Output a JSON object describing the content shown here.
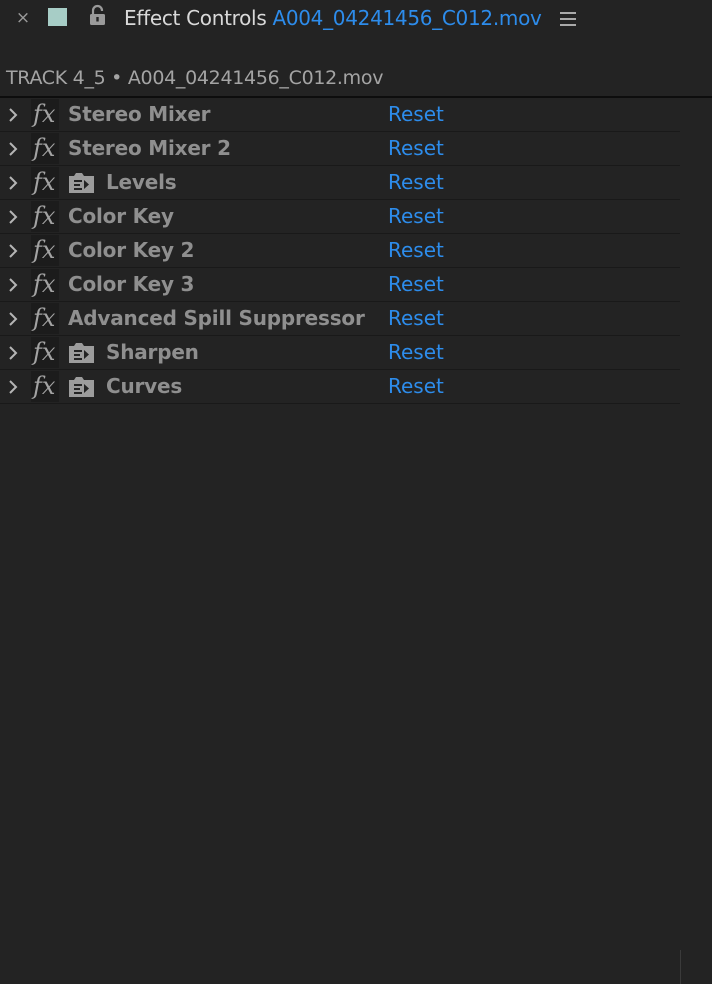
{
  "panel": {
    "title": "Effect Controls",
    "clip_name": "A004_04241456_C012.mov",
    "label_color": "#a7cdc6",
    "accent_color": "#2d8ceb",
    "close_glyph": "×",
    "icons": {
      "close": "close-icon",
      "lock": "lock-icon",
      "menu": "hamburger-menu-icon"
    }
  },
  "track_label": "TRACK 4_5 • A004_04241456_C012.mov",
  "effects": [
    {
      "name": "Stereo Mixer",
      "reset_label": "Reset",
      "has_preset_icon": false
    },
    {
      "name": "Stereo Mixer 2",
      "reset_label": "Reset",
      "has_preset_icon": false
    },
    {
      "name": "Levels",
      "reset_label": "Reset",
      "has_preset_icon": true
    },
    {
      "name": "Color Key",
      "reset_label": "Reset",
      "has_preset_icon": false
    },
    {
      "name": "Color Key 2",
      "reset_label": "Reset",
      "has_preset_icon": false
    },
    {
      "name": "Color Key 3",
      "reset_label": "Reset",
      "has_preset_icon": false
    },
    {
      "name": "Advanced Spill Suppressor",
      "reset_label": "Reset",
      "has_preset_icon": false
    },
    {
      "name": "Sharpen",
      "reset_label": "Reset",
      "has_preset_icon": true
    },
    {
      "name": "Curves",
      "reset_label": "Reset",
      "has_preset_icon": true
    }
  ],
  "fx_badge_text": "fx"
}
